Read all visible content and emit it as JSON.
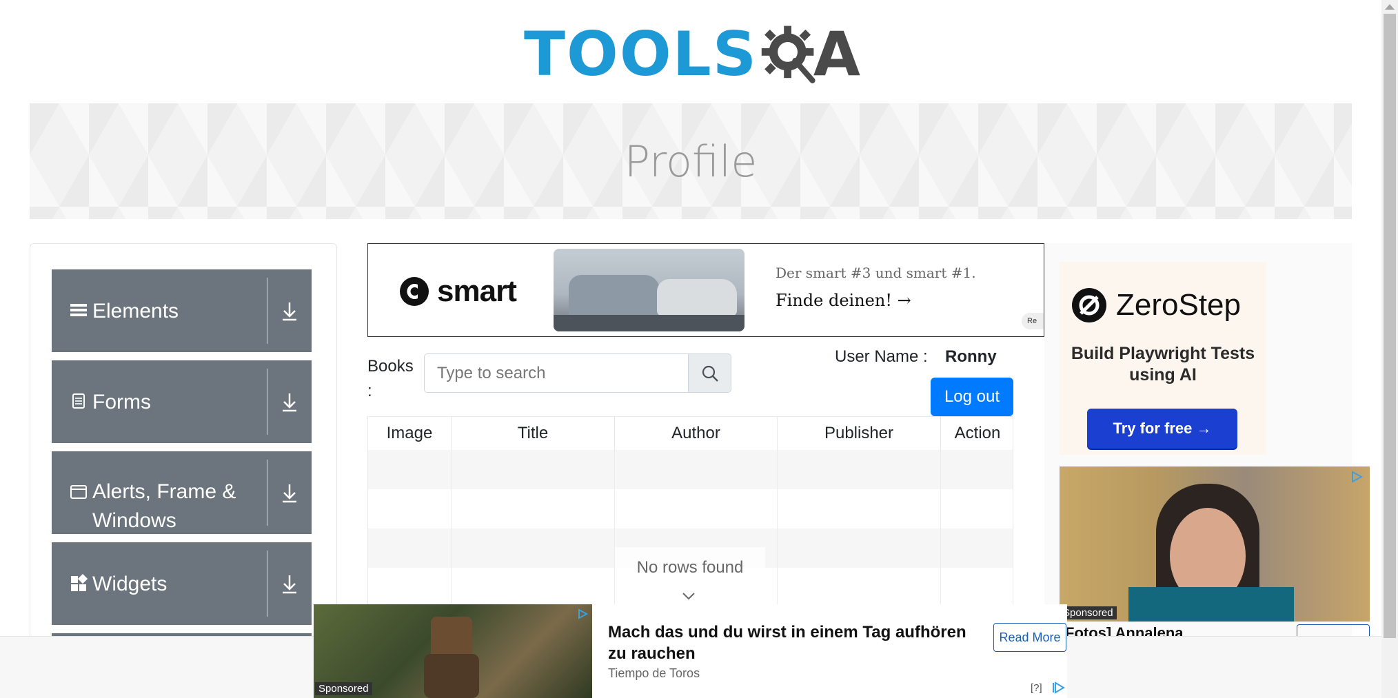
{
  "header": {
    "logo_text_primary": "TOOLS",
    "logo_text_secondary": "A",
    "brand_blue": "#1d9ad6",
    "brand_dark": "#4a4a4a"
  },
  "banner": {
    "title": "Profile"
  },
  "sidebar": {
    "groups": [
      {
        "label": "Elements",
        "icon": "hamburger-icon"
      },
      {
        "label": "Forms",
        "icon": "document-icon"
      },
      {
        "label": "Alerts, Frame & Windows",
        "icon": "browser-window-icon"
      },
      {
        "label": "Widgets",
        "icon": "widgets-icon"
      }
    ],
    "group_color": "#6c757d"
  },
  "ad_top": {
    "brand": "smart",
    "line1": "Der smart #3 und smart #1.",
    "line2": "Finde deinen! →",
    "adchoice": "Re"
  },
  "books": {
    "label": "Books :",
    "search_placeholder": "Type to search",
    "user_name_label": "User Name :",
    "user_name_value": "Ronny",
    "logout_label": "Log out",
    "accent": "#007bff"
  },
  "table": {
    "columns": [
      "Image",
      "Title",
      "Author",
      "Publisher",
      "Action"
    ],
    "empty_message": "No rows found"
  },
  "ad_right": {
    "brand": "ZeroStep",
    "tagline": "Build Playwright Tests using AI",
    "cta": "Try for free →",
    "photo_tag": "Sponsored",
    "photo_caption": "Fotos] Annalena"
  },
  "ad_bottom": {
    "tag": "Sponsored",
    "title": "Mach das und du wirst in einem Tag aufhören zu rauchen",
    "source": "Tiempo de Toros",
    "cta": "Read More",
    "help": "[?]"
  }
}
